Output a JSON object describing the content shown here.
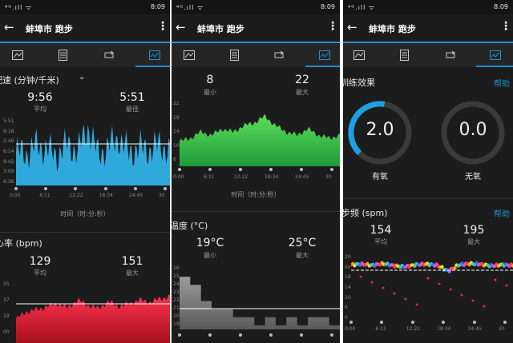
{
  "status_bar": {
    "left": "⁴ᴳ.ıll ᯤ",
    "time": "8:09",
    "icons": "✈ ✱ ▭"
  },
  "app": {
    "title": "蚌埠市 跑步"
  },
  "colors": {
    "accent": "#1f8ecf",
    "pace": "#2fa8dc",
    "heart": "#e8283c",
    "elev_top": "#44d24a",
    "temp": "#8a8a8a",
    "gauge_blue": "#1f9fe0"
  },
  "time_ticks": [
    "0:00",
    "6:11",
    "12:22",
    "18:34",
    "24:45",
    "30"
  ],
  "panel1": {
    "pace": {
      "title": "配速 (分钟/千米)",
      "avg_value": "9:56",
      "avg_label": "平均",
      "best_value": "5:51",
      "best_label": "最佳",
      "y_ticks": [
        "5:51",
        "9:18",
        "2:46",
        "6:14",
        "9:42",
        "3:09",
        "6:36"
      ],
      "xlabel": "时间（时:分:秒）"
    },
    "heart": {
      "title": "心率 (bpm)",
      "avg_value": "129",
      "avg_label": "平均",
      "max_value": "151",
      "max_label": "最大",
      "y_ticks": [
        "55",
        "37",
        "19",
        "00"
      ]
    }
  },
  "panel2": {
    "elevation": {
      "min_value": "8",
      "min_label": "最小",
      "max_value": "22",
      "max_label": "最大",
      "y_ticks": [
        "22",
        "18",
        "14",
        "10",
        "6"
      ],
      "xlabel": "时间（时:分:秒）"
    },
    "temperature": {
      "title": "温度 (°C)",
      "min_value": "19°C",
      "min_label": "最小",
      "max_value": "25°C",
      "max_label": "最大",
      "y_ticks": [
        "26",
        "25",
        "24",
        "23",
        "22",
        "21",
        "20",
        "19"
      ]
    }
  },
  "panel3": {
    "training": {
      "title": "训练效果",
      "help": "帮助",
      "aerobic_value": "2.0",
      "aerobic_label": "有氧",
      "aerobic_fraction": 0.4,
      "anaerobic_value": "0.0",
      "anaerobic_label": "无氧",
      "anaerobic_fraction": 0.0
    },
    "cadence": {
      "title": "步频 (spm)",
      "help": "帮助",
      "avg_value": "154",
      "avg_label": "平均",
      "max_value": "195",
      "max_label": "最大",
      "y_ticks": [
        "20",
        "60",
        "18",
        "14",
        "10",
        "6",
        "0"
      ]
    }
  },
  "chart_data": [
    {
      "type": "area",
      "title": "配速 (分钟/千米)",
      "x": [
        0,
        2,
        4,
        6,
        8,
        10,
        12,
        14,
        16,
        18,
        20,
        22,
        24,
        26,
        28,
        30
      ],
      "values": [
        9.5,
        9.3,
        10.4,
        9.9,
        9.1,
        10.6,
        9.6,
        12.8,
        9.2,
        10.2,
        11.4,
        9.4,
        10.1,
        9.8,
        10.5,
        9.6
      ]
    },
    {
      "type": "area",
      "title": "心率 (bpm)",
      "x": [
        0,
        2,
        4,
        6,
        8,
        10,
        12,
        14,
        16,
        18,
        20,
        22,
        24,
        26,
        28,
        30
      ],
      "values": [
        105,
        118,
        122,
        128,
        134,
        126,
        140,
        131,
        125,
        137,
        129,
        133,
        140,
        136,
        142,
        147
      ]
    },
    {
      "type": "area",
      "x": [
        0,
        2,
        4,
        6,
        8,
        10,
        12,
        14,
        16,
        18,
        20,
        22,
        24,
        26,
        28,
        30
      ],
      "values": [
        12,
        13,
        15,
        14,
        16,
        15,
        17,
        18,
        20,
        17,
        15,
        14,
        16,
        14,
        13,
        14
      ]
    },
    {
      "type": "area",
      "title": "温度 (°C)",
      "x": [
        0,
        2,
        4,
        6,
        8,
        10,
        12,
        14,
        16,
        18,
        20,
        22,
        24,
        26,
        28,
        30
      ],
      "values": [
        25,
        24,
        22,
        21,
        21,
        20,
        20,
        19,
        20,
        19,
        20,
        19,
        20,
        20,
        19,
        19
      ]
    },
    {
      "type": "scatter",
      "title": "步频 (spm)",
      "x": [
        0,
        2,
        4,
        6,
        8,
        10,
        12,
        14,
        16,
        18,
        20,
        22,
        24,
        26,
        28,
        30
      ],
      "values": [
        162,
        163,
        161,
        164,
        160,
        158,
        162,
        163,
        161,
        150,
        162,
        164,
        163,
        160,
        162,
        161
      ]
    }
  ]
}
